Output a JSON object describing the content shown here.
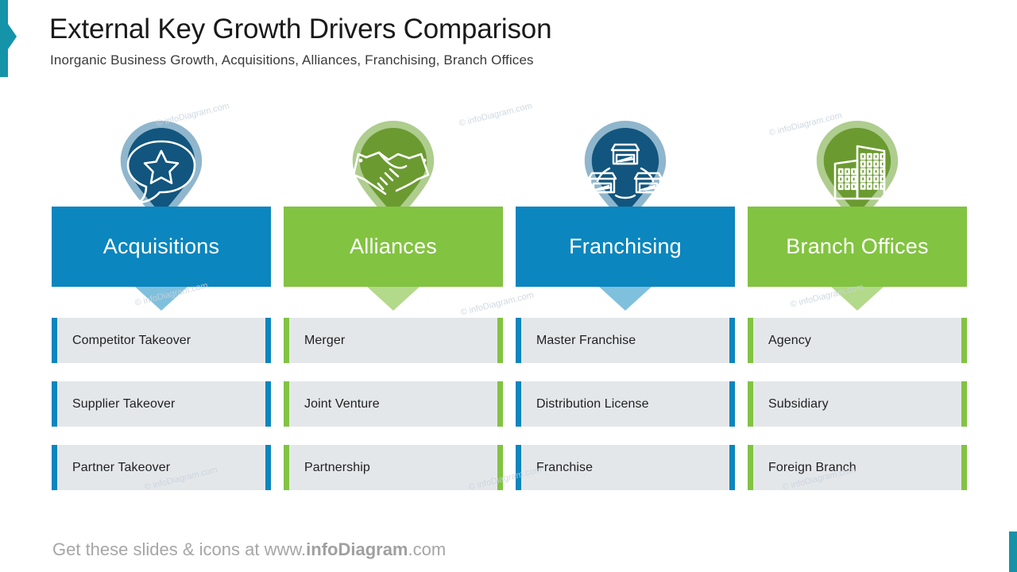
{
  "header": {
    "title": "External Key Growth Drivers Comparison",
    "subtitle": "Inorganic Business Growth, Acquisitions, Alliances, Franchising, Branch Offices"
  },
  "footer": {
    "prefix": "Get these slides & icons at www.",
    "brand": "infoDiagram",
    "suffix": ".com"
  },
  "watermark": {
    "text": "© infoDiagram.com"
  },
  "colors": {
    "teal_accent": "#1593a9",
    "blue": "#0b86be",
    "blue_dark": "#12557e",
    "blue_light": "#7fc0dd",
    "blue_ring": "#8fb6cc",
    "green": "#82c341",
    "green_dark": "#6b9a31",
    "green_light": "#b3d98a",
    "green_ring": "#aecd8e",
    "row_bg": "#e4e7ea",
    "text_dark": "#1f1f1f"
  },
  "columns": [
    {
      "id": "acquisitions",
      "label": "Acquisitions",
      "theme": "blue",
      "icon": "speech-bubble-star-icon",
      "items": [
        "Competitor Takeover",
        "Supplier Takeover",
        "Partner Takeover"
      ]
    },
    {
      "id": "alliances",
      "label": "Alliances",
      "theme": "green",
      "icon": "handshake-icon",
      "items": [
        "Merger",
        "Joint Venture",
        "Partnership"
      ]
    },
    {
      "id": "franchising",
      "label": "Franchising",
      "theme": "blue",
      "icon": "shops-network-icon",
      "items": [
        "Master Franchise",
        "Distribution License",
        "Franchise"
      ]
    },
    {
      "id": "branch-offices",
      "label": "Branch Offices",
      "theme": "green",
      "icon": "office-buildings-icon",
      "items": [
        "Agency",
        "Subsidiary",
        "Foreign Branch"
      ]
    }
  ]
}
